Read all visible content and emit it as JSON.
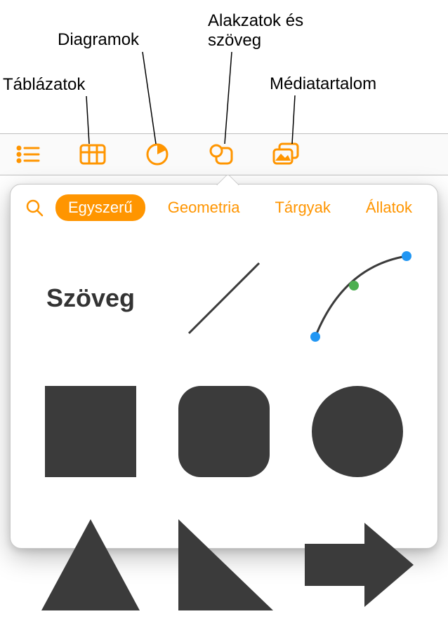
{
  "colors": {
    "accent": "#ff9500",
    "shape_fill": "#3b3b3b",
    "icon_stroke": "#ff9500"
  },
  "callouts": {
    "tables": "Táblázatok",
    "charts": "Diagramok",
    "shapes_text": "Alakzatok és\nszöveg",
    "media": "Médiatartalom"
  },
  "toolbar": {
    "items": [
      {
        "name": "list"
      },
      {
        "name": "table"
      },
      {
        "name": "chart"
      },
      {
        "name": "shape"
      },
      {
        "name": "media"
      }
    ]
  },
  "popover": {
    "search_placeholder": "Keresés",
    "categories": [
      {
        "label": "Egyszerű",
        "selected": true
      },
      {
        "label": "Geometria",
        "selected": false
      },
      {
        "label": "Tárgyak",
        "selected": false
      },
      {
        "label": "Állatok",
        "selected": false
      }
    ],
    "text_shape_label": "Szöveg",
    "shapes": [
      "text",
      "line",
      "curve",
      "square",
      "rounded-square",
      "circle",
      "triangle",
      "right-triangle",
      "arrow-right"
    ]
  }
}
